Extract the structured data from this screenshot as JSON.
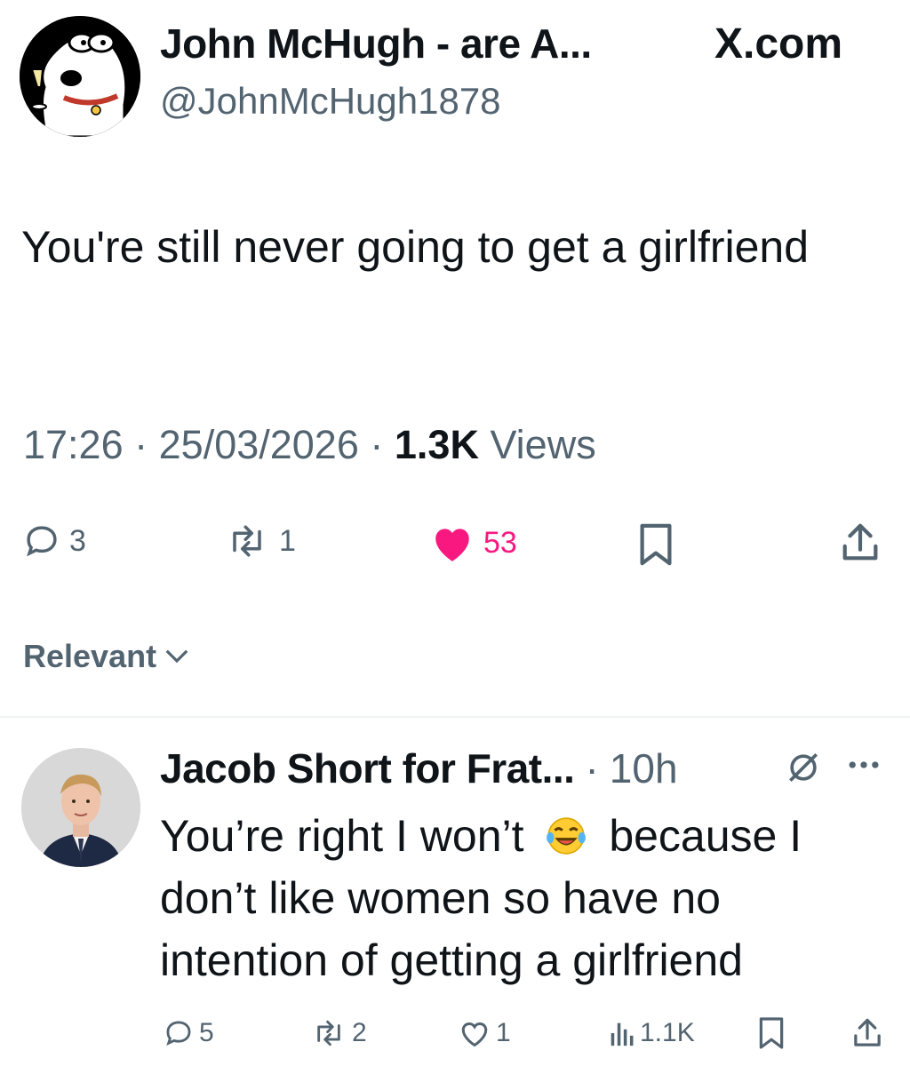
{
  "post": {
    "author_name": "John McHugh - are A...",
    "handle": "@JohnMcHugh1878",
    "brand": "X.com",
    "text": "You're still never going to get a girlfriend",
    "time": "17:26",
    "date": "25/03/2026",
    "views_count": "1.3K",
    "views_label": "Views",
    "replies": "3",
    "reposts": "1",
    "likes": "53",
    "like_color": "#f91880"
  },
  "filter": {
    "label": "Relevant"
  },
  "reply": {
    "author_name": "Jacob Short for Frat...",
    "time": "10h",
    "text_before_emoji": "You’re right I won’t",
    "text_after_emoji": "because I don’t like women so have no intention of getting a girlfriend",
    "replies": "5",
    "reposts": "2",
    "likes": "1",
    "views": "1.1K"
  },
  "colors": {
    "text": "#0f1419",
    "secondary": "#536471",
    "like": "#f91880"
  }
}
